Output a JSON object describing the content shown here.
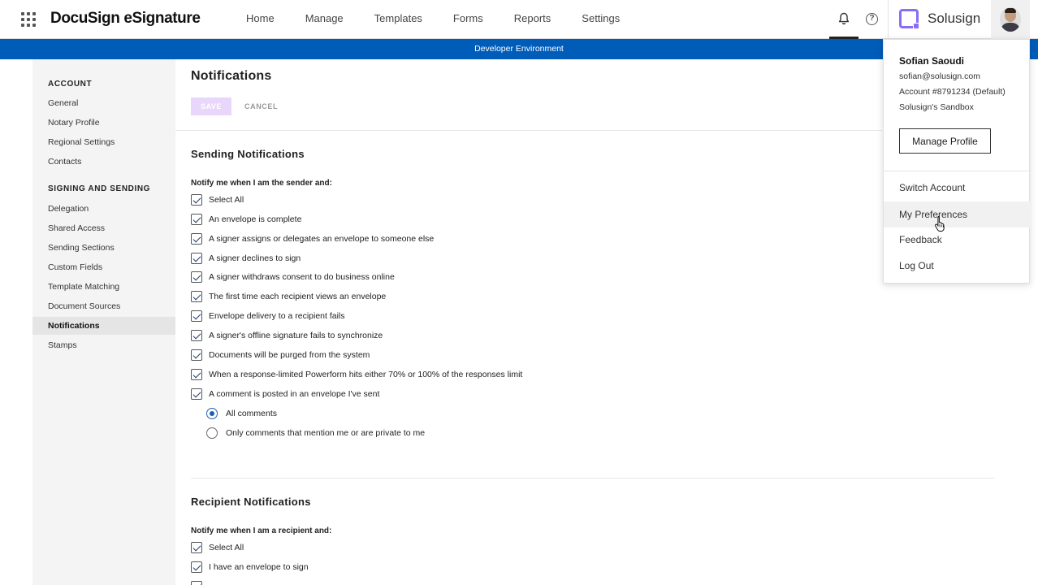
{
  "header": {
    "brand": "DocuSign eSignature",
    "nav": [
      "Home",
      "Manage",
      "Templates",
      "Forms",
      "Reports",
      "Settings"
    ],
    "company": "Solusign"
  },
  "dev_banner": "Developer Environment",
  "sidebar": {
    "sections": [
      {
        "title": "ACCOUNT",
        "items": [
          "General",
          "Notary Profile",
          "Regional Settings",
          "Contacts"
        ]
      },
      {
        "title": "SIGNING AND SENDING",
        "items": [
          "Delegation",
          "Shared Access",
          "Sending Sections",
          "Custom Fields",
          "Template Matching",
          "Document Sources",
          "Notifications",
          "Stamps"
        ]
      }
    ],
    "active": "Notifications"
  },
  "main": {
    "title": "Notifications",
    "save_label": "SAVE",
    "cancel_label": "CANCEL",
    "sending": {
      "title": "Sending Notifications",
      "group_label": "Notify me when I am the sender and:",
      "options": [
        "Select All",
        "An envelope is complete",
        "A signer assigns or delegates an envelope to someone else",
        "A signer declines to sign",
        "A signer withdraws consent to do business online",
        "The first time each recipient views an envelope",
        "Envelope delivery to a recipient fails",
        "A signer's offline signature fails to synchronize",
        "Documents will be purged from the system",
        "When a response-limited Powerform hits either 70% or 100% of the responses limit",
        "A comment is posted in an envelope I've sent"
      ],
      "comment_options": [
        "All comments",
        "Only comments that mention me or are private to me"
      ],
      "comment_selected": "All comments"
    },
    "recipient": {
      "title": "Recipient Notifications",
      "group_label": "Notify me when I am a recipient and:",
      "options": [
        "Select All",
        "I have an envelope to sign"
      ]
    }
  },
  "profile_menu": {
    "name": "Sofian Saoudi",
    "email": "sofian@solusign.com",
    "account": "Account #8791234 (Default)",
    "org": "Solusign's Sandbox",
    "manage_label": "Manage Profile",
    "items": [
      "Switch Account",
      "My Preferences",
      "Feedback",
      "Log Out"
    ],
    "hovered": "My Preferences"
  }
}
